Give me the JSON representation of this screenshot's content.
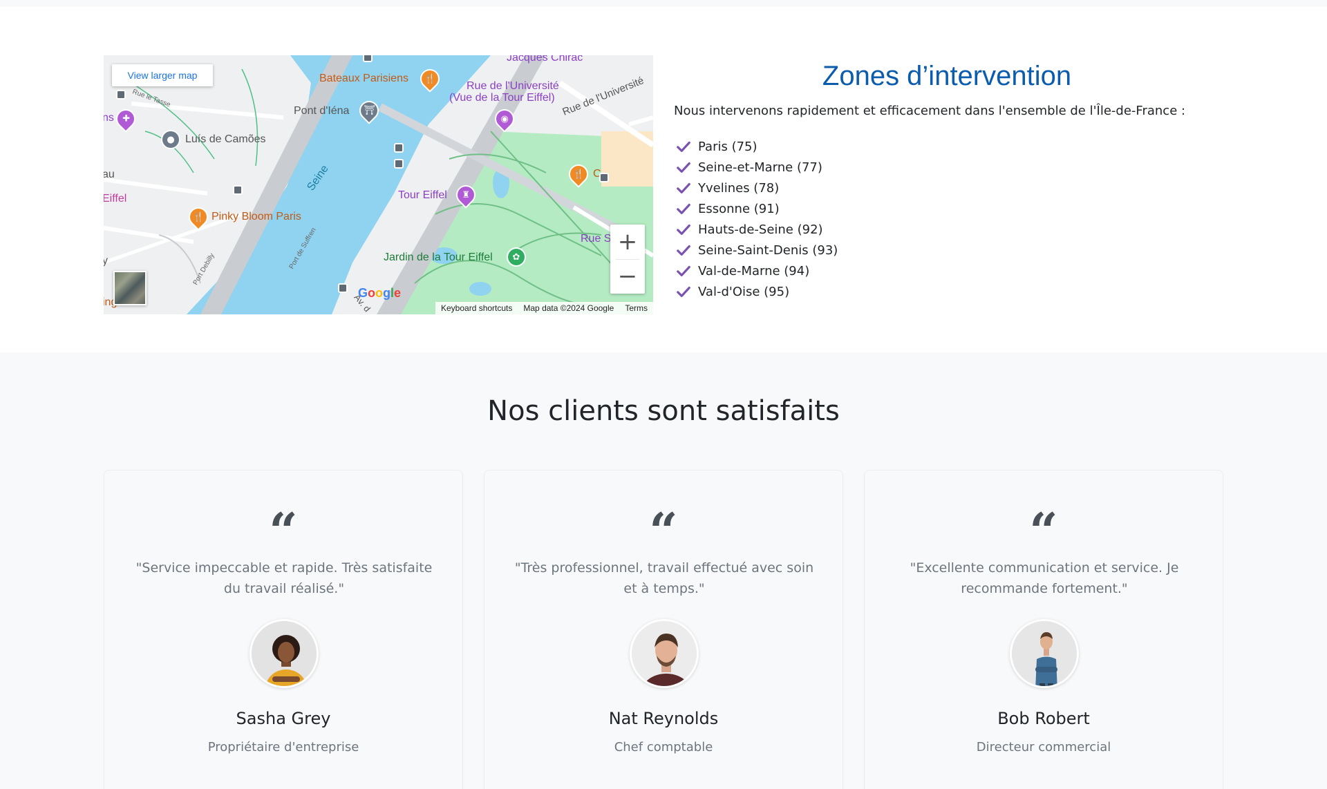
{
  "map": {
    "view_larger": "View larger map",
    "labels": {
      "jacques_chirac": "Jacques Chirac",
      "bateaux": "Bateaux Parisiens",
      "rue_universite_1": "Rue de l'Université",
      "rue_universite_2": "(Vue de la Tour Eiffel)",
      "rue_universite_diag": "Rue de l'Université",
      "rue_le_tasse": "Rue le Tasse",
      "pont_iena": "Pont d'Iéna",
      "luis_camoes": "Luís de Camões",
      "seine": "Seine",
      "tour_eiffel": "Tour Eiffel",
      "eiffel_left": "Eiffel",
      "au_left": "au",
      "ns_left": "ns",
      "pinky_bloom": "Pinky Bloom Paris",
      "port_suffren": "Port de Suffren",
      "port_debilly": "Port Debilly",
      "rue_s": "Rue S",
      "jardin": "Jardin de la Tour Eiffel",
      "av_d": "Av. d",
      "y_left": "y",
      "ing_left": "ing",
      "c_right": "C"
    },
    "zoom_in": "+",
    "zoom_out": "−",
    "google": [
      "G",
      "o",
      "o",
      "g",
      "l",
      "e"
    ],
    "keyboard_shortcuts": "Keyboard shortcuts",
    "map_data": "Map data ©2024 Google",
    "terms": "Terms"
  },
  "zones": {
    "title": "Zones d’intervention",
    "intro": "Nous intervenons rapidement et efficacement dans l'ensemble de l'Île-de-France :",
    "items": [
      "Paris (75)",
      "Seine-et-Marne (77)",
      "Yvelines (78)",
      "Essonne (91)",
      "Hauts-de-Seine (92)",
      "Seine-Saint-Denis (93)",
      "Val-de-Marne (94)",
      "Val-d'Oise (95)"
    ]
  },
  "clients": {
    "title": "Nos clients sont satisfaits",
    "quote_glyph": "“",
    "testimonials": [
      {
        "text": "\"Service impeccable et rapide. Très satisfaite du travail réalisé.\"",
        "name": "Sasha Grey",
        "role": "Propriétaire d'entreprise"
      },
      {
        "text": "\"Très professionnel, travail effectué avec soin et à temps.\"",
        "name": "Nat Reynolds",
        "role": "Chef comptable"
      },
      {
        "text": "\"Excellente communication et service. Je recommande fortement.\"",
        "name": "Bob Robert",
        "role": "Directeur commercial"
      }
    ]
  },
  "colors": {
    "title_blue": "#0b5cad",
    "check_purple": "#7952b3",
    "water": "#8fd3f0",
    "park": "#b5ebc3"
  }
}
